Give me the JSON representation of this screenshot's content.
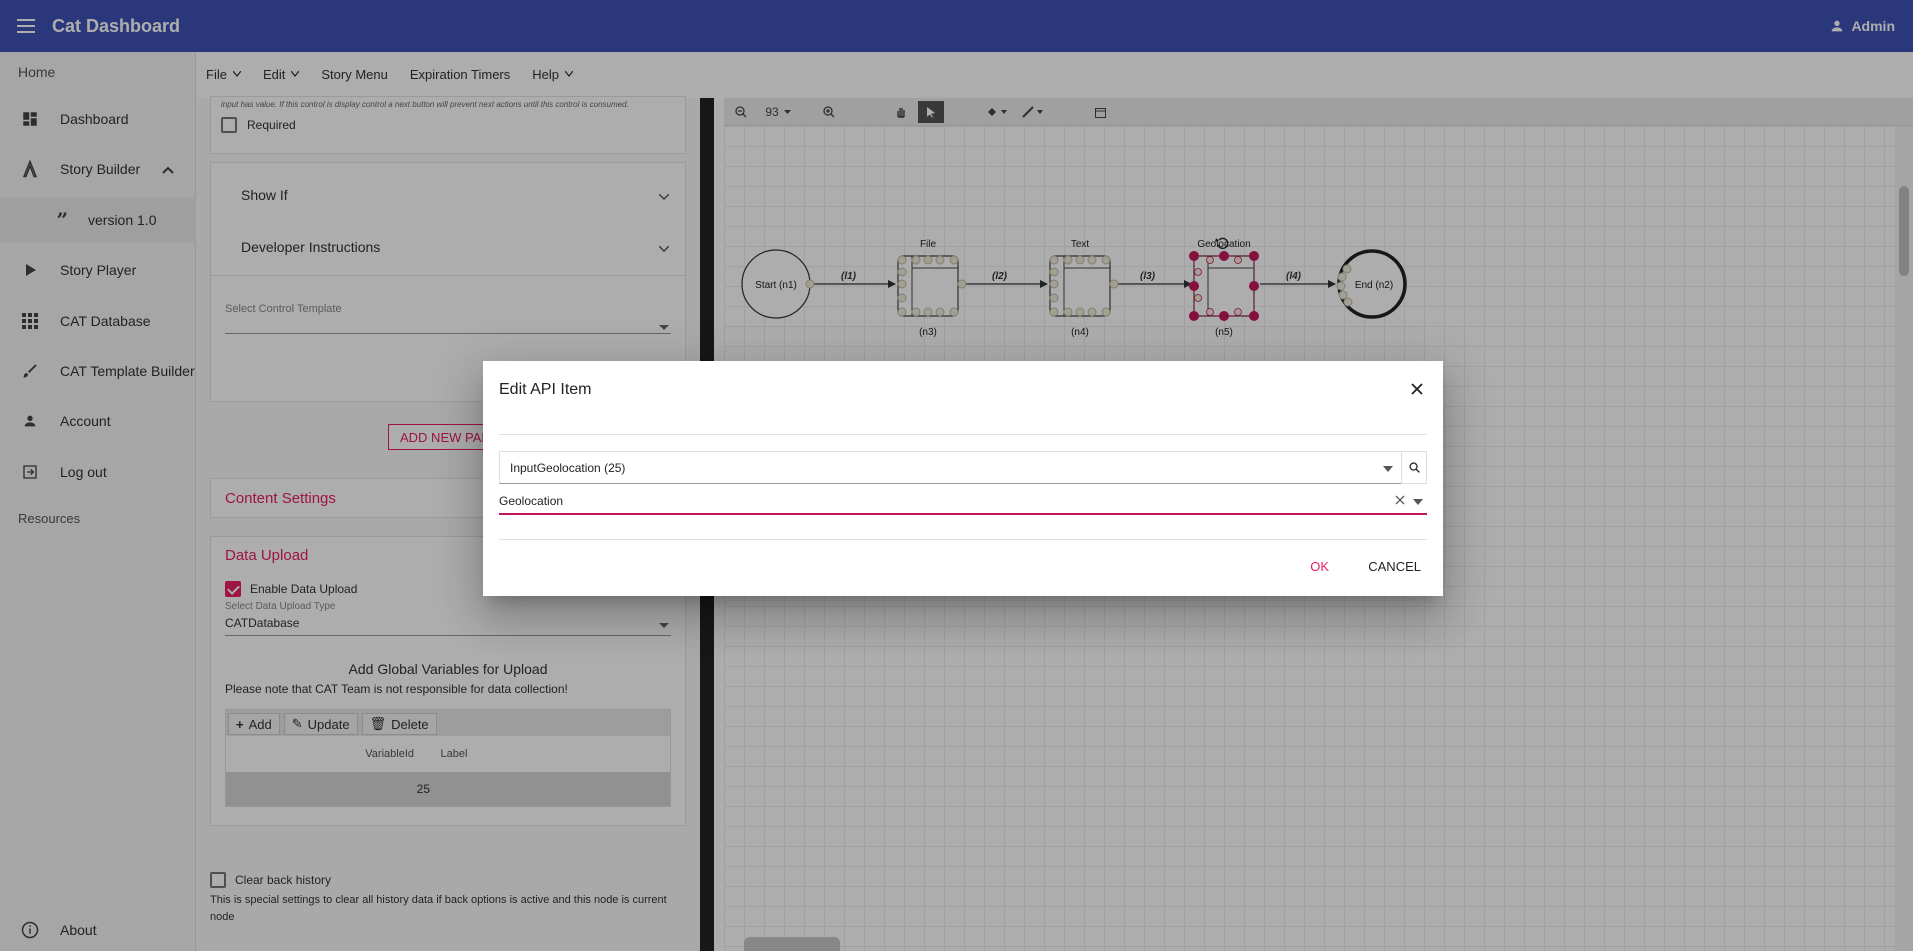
{
  "app": {
    "title": "Cat Dashboard",
    "user": "Admin"
  },
  "sidebar": {
    "home_label": "Home",
    "items": [
      {
        "label": "Dashboard",
        "icon": "dashboard-icon"
      },
      {
        "label": "Story Builder",
        "icon": "compass-icon"
      },
      {
        "label": "version 1.0",
        "icon": "quote-icon"
      },
      {
        "label": "Story Player",
        "icon": "play-icon"
      },
      {
        "label": "CAT Database",
        "icon": "grid-icon"
      },
      {
        "label": "CAT Template Builder",
        "icon": "brush-icon"
      },
      {
        "label": "Account",
        "icon": "person-icon"
      },
      {
        "label": "Log out",
        "icon": "logout-icon"
      }
    ],
    "resources_label": "Resources",
    "about_label": "About"
  },
  "menubar": {
    "items": [
      "File",
      "Edit",
      "Story Menu",
      "Expiration Timers",
      "Help"
    ]
  },
  "editor": {
    "hint_text": "input has value. If this control is display control a next button will prevent next actions until this control is consumed.",
    "required_label": "Required",
    "show_if_label": "Show If",
    "developer_instructions_label": "Developer Instructions",
    "select_control_template_label": "Select Control Template",
    "add_new_panel_label": "ADD NEW PANEL",
    "content_settings_label": "Content Settings",
    "data_upload_label": "Data Upload",
    "enable_data_upload_label": "Enable Data Upload",
    "select_data_upload_type_label": "Select Data Upload Type",
    "data_upload_type_value": "CATDatabase",
    "global_vars_title": "Add Global Variables for Upload",
    "global_vars_note": "Please note that CAT Team is not responsible for data collection!",
    "toolbar": {
      "add": "Add",
      "update": "Update",
      "delete": "Delete"
    },
    "table": {
      "columns": [
        "VariableId",
        "Label"
      ],
      "rows": [
        [
          "25",
          ""
        ]
      ]
    },
    "clear_back_history_label": "Clear back history",
    "clear_back_history_note": "This is special settings to clear all history data if back options is active and this node is current node"
  },
  "canvas": {
    "zoom": "93",
    "nodes": [
      {
        "label": "Start (n1)",
        "kind": "start"
      },
      {
        "title": "File",
        "id": "(n3)",
        "kind": "box"
      },
      {
        "title": "Text",
        "id": "(n4)",
        "kind": "box"
      },
      {
        "title": "Geolocation",
        "id": "(n5)",
        "kind": "box-selected"
      },
      {
        "label": "End (n2)",
        "kind": "end"
      }
    ],
    "links": [
      "(l1)",
      "(l2)",
      "(l3)",
      "(l4)"
    ]
  },
  "dialog": {
    "title": "Edit API Item",
    "api_select_value": "InputGeolocation (25)",
    "field_value": "Geolocation",
    "ok_label": "OK",
    "cancel_label": "CANCEL"
  },
  "colors": {
    "primary": "#3f51b5",
    "accent": "#e91e63",
    "selected_node": "#c2185b"
  }
}
